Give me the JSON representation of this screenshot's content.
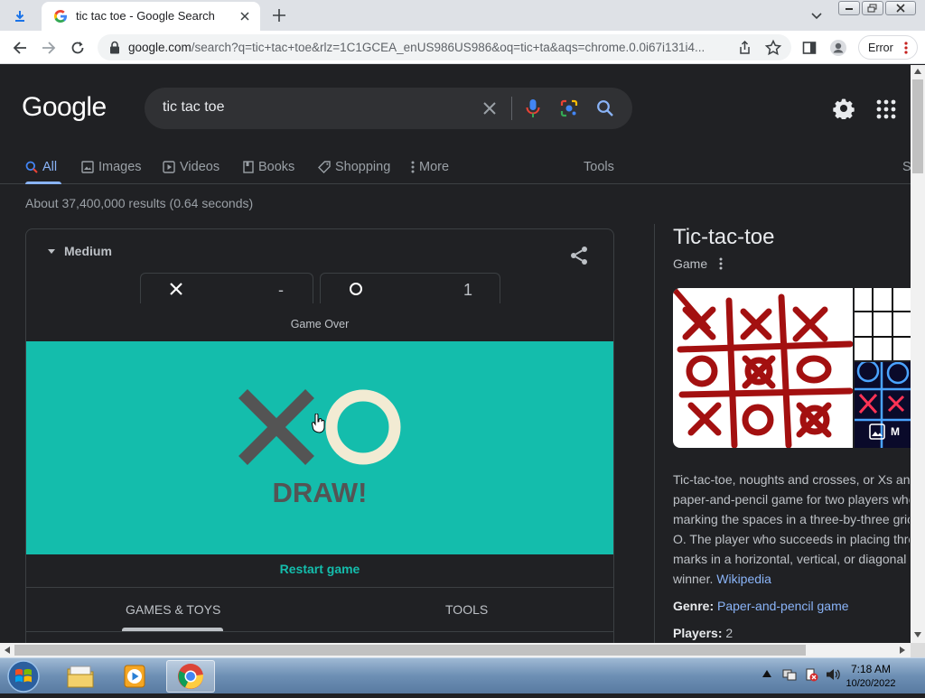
{
  "browser": {
    "tab_title": "tic tac toe - Google Search",
    "url_host": "google.com",
    "url_rest": "/search?q=tic+tac+toe&rlz=1C1GCEA_enUS986US986&oq=tic+ta&aqs=chrome.0.0i67i131i4...",
    "profile_button": "Error"
  },
  "search": {
    "logo": "Google",
    "query": "tic tac toe",
    "tabs": [
      {
        "label": "All",
        "icon": "search-icon",
        "active": true
      },
      {
        "label": "Images",
        "icon": "image-icon"
      },
      {
        "label": "Videos",
        "icon": "play-icon"
      },
      {
        "label": "Books",
        "icon": "book-icon"
      },
      {
        "label": "Shopping",
        "icon": "tag-icon"
      },
      {
        "label": "More",
        "icon": "kebab-icon"
      }
    ],
    "tools": "Tools",
    "tab_cut": "S",
    "stats": "About 37,400,000 results (0.64 seconds)"
  },
  "game": {
    "difficulty": "Medium",
    "score_x": "-",
    "score_o": "1",
    "status": "Game Over",
    "result": "DRAW!",
    "restart": "Restart game",
    "bottom_tabs": [
      "GAMES & TOYS",
      "TOOLS"
    ],
    "board_color": "#14bdac"
  },
  "knowledge_panel": {
    "title": "Tic-tac-toe",
    "subtitle": "Game",
    "more_images": "M",
    "description_lines": [
      "Tic-tac-toe, noughts and crosses, or Xs an",
      "paper-and-pencil game for two players who",
      "marking the spaces in a three-by-three gric",
      "O. The player who succeeds in placing thre",
      "marks in a horizontal, vertical, or diagonal",
      "winner."
    ],
    "source": "Wikipedia",
    "genre_label": "Genre:",
    "genre": "Paper-and-pencil game",
    "players_label": "Players:",
    "players": "2"
  },
  "taskbar": {
    "time": "7:18 AM",
    "date": "10/20/2022"
  }
}
